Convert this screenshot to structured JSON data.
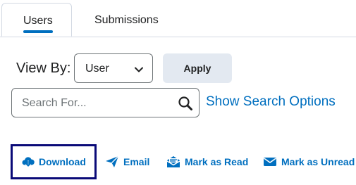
{
  "tabs": [
    {
      "label": "Users",
      "selected": true
    },
    {
      "label": "Submissions",
      "selected": false
    }
  ],
  "view_by": {
    "label": "View By:",
    "selected": "User",
    "apply_label": "Apply"
  },
  "search": {
    "placeholder": "Search For...",
    "options_link": "Show Search Options"
  },
  "actions": [
    {
      "label": "Download",
      "icon": "cloud-download-icon",
      "focused": true
    },
    {
      "label": "Email",
      "icon": "paper-plane-icon"
    },
    {
      "label": "Mark as Read",
      "icon": "envelope-open-icon"
    },
    {
      "label": "Mark as Unread",
      "icon": "envelope-icon"
    }
  ],
  "colors": {
    "accent": "#006fbf",
    "focus_ring": "#0a0a78",
    "button_bg": "#e3e9f1",
    "border": "#6e7477"
  }
}
